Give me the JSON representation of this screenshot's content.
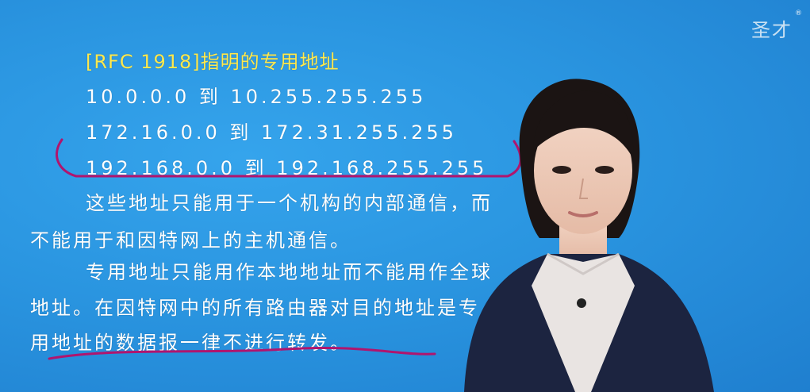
{
  "slide": {
    "heading": "[RFC 1918]指明的专用地址",
    "ranges": [
      "10.0.0.0 到 10.255.255.255",
      "172.16.0.0 到 172.31.255.255",
      "192.168.0.0 到 192.168.255.255"
    ],
    "paragraph_lines": [
      "这些地址只能用于一个机构的内部通信，而",
      "不能用于和因特网上的主机通信。",
      "专用地址只能用作本地地址而不能用作全球",
      "地址。在因特网中的所有路由器对目的地址是专",
      "用地址的数据报一律不进行转发。"
    ]
  },
  "logo": {
    "text": "圣才",
    "mark": "®"
  },
  "colors": {
    "background": "#2a95e0",
    "heading": "#ffe94d",
    "text": "#ffffff",
    "annotation": "#b0156e"
  }
}
